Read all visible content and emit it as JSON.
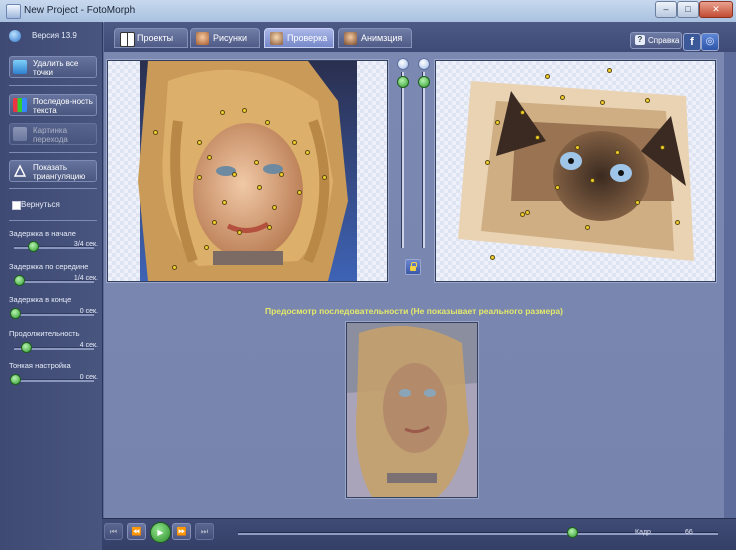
{
  "window": {
    "title": "New Project - FotoMorph",
    "controls": {
      "minimize": "–",
      "maximize": "□",
      "close": "✕"
    }
  },
  "version": "Версия 13.9",
  "left_panel": {
    "buttons": [
      {
        "label": "Удалить все точки",
        "icon": "delete-points-icon",
        "enabled": true
      },
      {
        "label": "Последов-ность текста",
        "icon": "sequence-text-icon",
        "enabled": true
      },
      {
        "label": "Картинка перехода",
        "icon": "transition-picture-icon",
        "enabled": false
      },
      {
        "label": "Показать триангуляцию",
        "icon": "triangle-icon",
        "enabled": true
      }
    ],
    "return_checkbox": {
      "label": "Вернуться",
      "checked": false
    },
    "sliders": [
      {
        "label": "Задержка в начале",
        "value": "3/4 сек.",
        "fraction": 0.25
      },
      {
        "label": "Задержка по середине",
        "value": "1/4 сек.",
        "fraction": 0.05
      },
      {
        "label": "Задержка в конце",
        "value": "0 сек.",
        "fraction": 0.0
      },
      {
        "label": "Продолжительность",
        "value": "4 сек.",
        "fraction": 0.15
      },
      {
        "label": "Тонкая настройка",
        "value": "0 сек.",
        "fraction": 0.0
      }
    ]
  },
  "tabs": [
    {
      "label": "Проекты",
      "icon": "projects-icon",
      "active": false
    },
    {
      "label": "Рисунки",
      "icon": "pictures-icon",
      "active": false
    },
    {
      "label": "Проверка",
      "icon": "check-icon",
      "active": true
    },
    {
      "label": "Анимзция",
      "icon": "animation-icon",
      "active": false
    }
  ],
  "toolbar": {
    "help_label": "Справка",
    "facebook_label": "f",
    "globe_label": "◎"
  },
  "preview": {
    "label": "Предосмотр последовательности (Не показывает реального размера)"
  },
  "bottom": {
    "buttons": [
      "⏮",
      "⏪",
      "▶",
      "⏩",
      "⏭"
    ],
    "frame_label": "Кадр",
    "frame_value": "66",
    "timeline_fraction": 0.7
  },
  "colors": {
    "accent_active_tab": "#8fa0dc",
    "panel": "#45517b",
    "slider_green": "#2f9a2c",
    "points": "#f2cf2d",
    "preview_text": "#e4e96a"
  }
}
